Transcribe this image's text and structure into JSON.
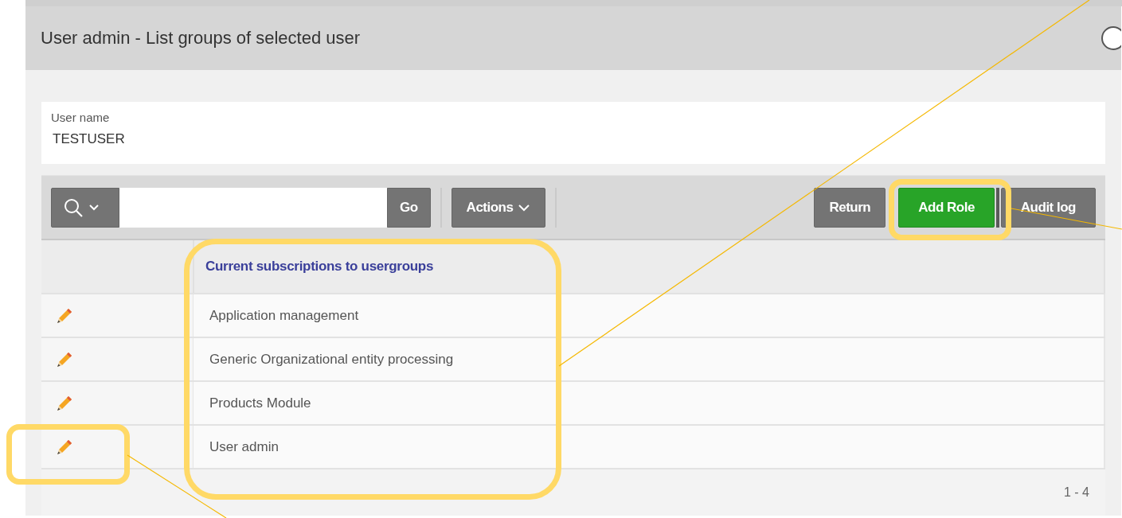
{
  "dialog": {
    "title": "User admin - List groups of selected user"
  },
  "user_name": {
    "label": "User name",
    "value": "TESTUSER"
  },
  "toolbar": {
    "go": "Go",
    "actions": "Actions",
    "buttons": [
      {
        "label": "Return",
        "kind": "default"
      },
      {
        "label": "Add Role",
        "kind": "primary"
      },
      {
        "label": "Audit log",
        "kind": "default"
      }
    ]
  },
  "table": {
    "columns": [
      "Current subscriptions to usergroups"
    ],
    "rows": [
      {
        "name": "Application management"
      },
      {
        "name": "Generic Organizational entity processing"
      },
      {
        "name": "Products Module"
      },
      {
        "name": "User admin"
      }
    ],
    "pagination": "1 - 4"
  }
}
